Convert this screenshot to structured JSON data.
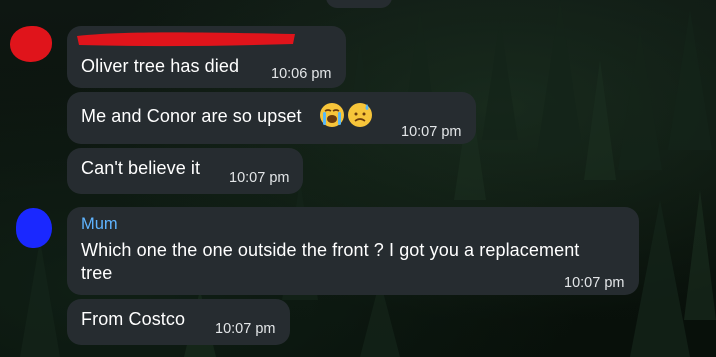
{
  "colors": {
    "bubble": "#262c30",
    "sender_name": "#5fb4ff",
    "avatar_1": "#e0141b",
    "avatar_2": "#1a28ff",
    "redaction": "#e0141b"
  },
  "messages": [
    {
      "text": "Oliver tree has died",
      "time": "10:06 pm"
    },
    {
      "text": "Me and Conor are so upset",
      "emoji": [
        "loudly-crying-face-icon",
        "sad-but-relieved-face-icon"
      ],
      "time": "10:07 pm"
    },
    {
      "text": "Can't believe it",
      "time": "10:07 pm"
    }
  ],
  "reply": {
    "sender": "Mum",
    "line_1": "Which one the one outside the front ? I got you a replacement",
    "line_2": "tree",
    "time": "10:07 pm"
  },
  "followup": {
    "text": "From Costco",
    "time": "10:07 pm"
  }
}
